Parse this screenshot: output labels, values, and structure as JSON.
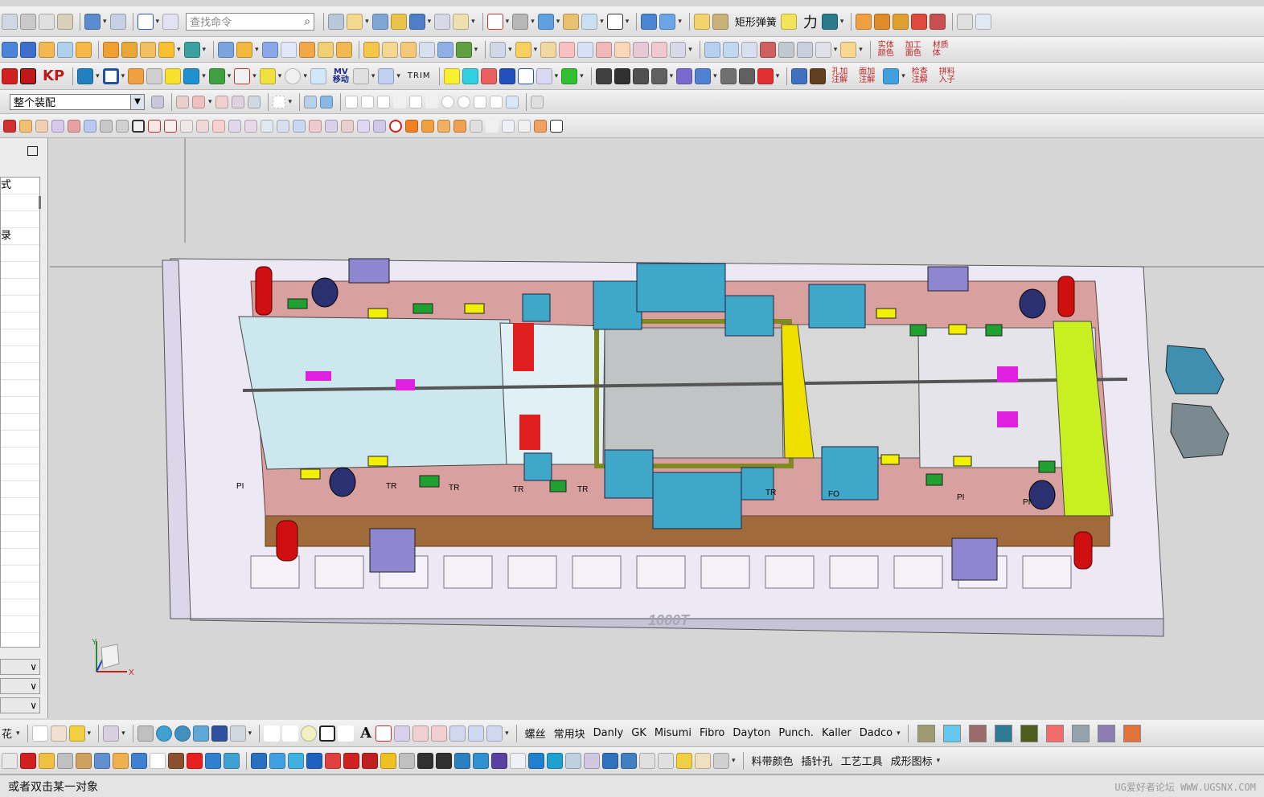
{
  "toolbar1": {
    "search_placeholder": "查找命令",
    "spring_label": "矩形弹簧",
    "force_label": "力"
  },
  "toolbar3": {
    "label_kp": "KP",
    "label_mv": "MV",
    "label_mv_sub": "移动",
    "label_trim": "TRIM"
  },
  "toolbar4": {
    "assembly_filter": "整个装配"
  },
  "right_labels": {
    "r2_a": "实体颜色",
    "r2_b": "加工面色",
    "r2_c": "材质体",
    "r3_a": "孔加注解",
    "r3_b": "面加注解",
    "r3_c": "检查注解",
    "r3_d": "拼料入子"
  },
  "left_panel": {
    "tab_fragment_1": "式",
    "tab_fragment_2": "录"
  },
  "viewport": {
    "press_label": "1000T",
    "axis_x": "X",
    "axis_y": "Y",
    "labels_pi": "PI",
    "labels_tr": "TR",
    "labels_fo": "FO"
  },
  "bottom_toolbar1": {
    "left_fragment": "花",
    "text_tools": [
      "螺丝",
      "常用块",
      "Danly",
      "GK",
      "Misumi",
      "Fibro",
      "Dayton",
      "Punch.",
      "Kaller",
      "Dadco"
    ],
    "swatches": [
      "#a09a72",
      "#63c7f0",
      "#9b6b6b",
      "#2e7a94",
      "#4f5d1a",
      "#f26a6a",
      "#93a4ad",
      "#8c7eb3",
      "#e0733a"
    ]
  },
  "bottom_toolbar2": {
    "text_tools": [
      "料带颜色",
      "插针孔",
      "工艺工具",
      "成形图标"
    ]
  },
  "status": {
    "message": "或者双击某一对象",
    "watermark": "UG爱好者论坛 WWW.UGSNX.COM"
  }
}
